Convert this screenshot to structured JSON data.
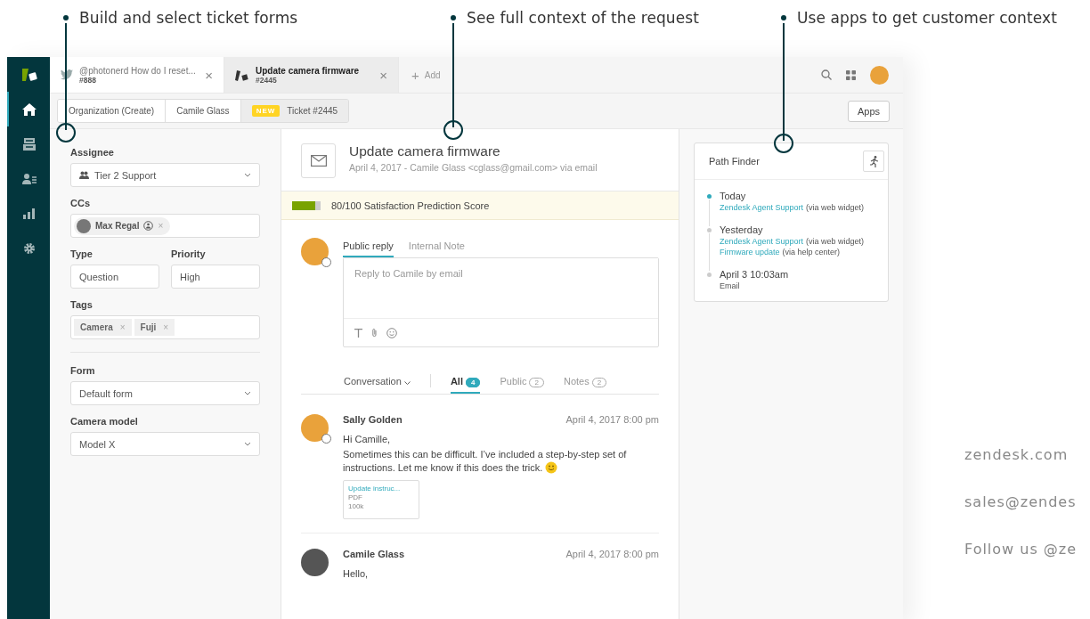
{
  "callouts": [
    "Build and select ticket forms",
    "See full context of the request",
    "Use apps to get customer context"
  ],
  "nav": [
    {
      "kind": "logo",
      "selected": false
    },
    {
      "kind": "home",
      "selected": true
    },
    {
      "kind": "views",
      "selected": false
    },
    {
      "kind": "customers",
      "selected": false
    },
    {
      "kind": "reports",
      "selected": false
    },
    {
      "kind": "settings",
      "selected": false
    }
  ],
  "ticket_tabs": [
    {
      "kind": "twitter",
      "title": "@photonerd How do I reset...",
      "number": "#888",
      "close": "×",
      "selected": false
    },
    {
      "kind": "ticket",
      "title": "Update camera firmware",
      "number": "#2445",
      "close": "×",
      "selected": true
    }
  ],
  "add_tab": {
    "icon": "+",
    "label": "Add"
  },
  "breadcrumbs": [
    {
      "label": "Organization (Create)",
      "selected": false
    },
    {
      "label": "Camile Glass",
      "selected": false
    },
    {
      "badge": "NEW",
      "label": "Ticket #2445",
      "selected": true
    }
  ],
  "apps_button": "Apps",
  "properties": {
    "assignee": {
      "label": "Assignee",
      "value": "Tier 2 Support"
    },
    "ccs": {
      "label": "CCs",
      "people": [
        {
          "name": "Max Regal",
          "remove": "×"
        }
      ]
    },
    "type": {
      "label": "Type",
      "value": "Question"
    },
    "priority": {
      "label": "Priority",
      "value": "High"
    },
    "tags": {
      "label": "Tags",
      "items": [
        {
          "name": "Camera",
          "remove": "×"
        },
        {
          "name": "Fuji",
          "remove": "×"
        }
      ]
    },
    "form": {
      "label": "Form",
      "value": "Default form"
    },
    "camera_model": {
      "label": "Camera model",
      "value": "Model X"
    }
  },
  "ticket": {
    "title": "Update camera firmware",
    "meta": "April 4, 2017 - Camile Glass <cglass@gmail.com> via email",
    "satisfaction": {
      "level": 0.8,
      "text": "80/100 Satisfaction Prediction Score"
    },
    "reply_tabs": [
      {
        "label": "Public reply",
        "selected": true
      },
      {
        "label": "Internal Note",
        "selected": false
      }
    ],
    "reply_placeholder": "Reply to Camile by email",
    "conversation_menu": "Conversation",
    "filters": [
      {
        "label": "All",
        "count": "4",
        "selected": true
      },
      {
        "label": "Public",
        "count": "2",
        "selected": false
      },
      {
        "label": "Notes",
        "count": "2",
        "selected": false
      }
    ],
    "messages": [
      {
        "author": "Sally Golden",
        "time": "April 4, 2017 8:00 pm",
        "agent": true,
        "lines": [
          "Hi Camille,",
          "Sometimes this can be difficult. I’ve included a step-by-step set of instructions. Let me know if this does the trick."
        ],
        "smiley": true,
        "attachment": {
          "name": "Update instruc...",
          "type": "PDF",
          "size": "100k"
        }
      },
      {
        "author": "Camile Glass",
        "time": "April 4, 2017 8:00 pm",
        "agent": false,
        "lines": [
          "Hello,"
        ],
        "smiley": false
      }
    ]
  },
  "path_finder": {
    "title": "Path Finder",
    "events": [
      {
        "when": "Today",
        "current": true,
        "entries": [
          {
            "link": "Zendesk Agent Support",
            "via": "(via web widget)"
          }
        ]
      },
      {
        "when": "Yesterday",
        "current": false,
        "entries": [
          {
            "link": "Zendesk Agent Support",
            "via": "(via web widget)"
          },
          {
            "link": "Firmware update",
            "via": "(via help center)"
          }
        ]
      },
      {
        "when": "April 3 10:03am",
        "current": false,
        "detail": "Email"
      }
    ]
  },
  "contact": [
    "zendesk.com",
    "sales@zendes",
    "Follow us @ze"
  ]
}
